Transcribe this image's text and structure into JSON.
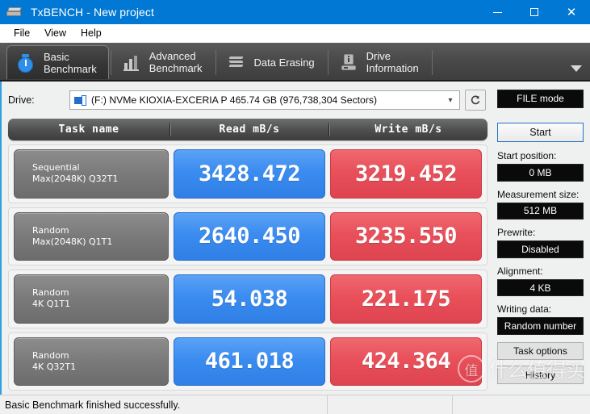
{
  "window": {
    "title": "TxBENCH - New project",
    "icon": "drive-icon",
    "minimize_label": "—",
    "maximize_label": "□",
    "close_label": "✕"
  },
  "menu": {
    "items": [
      {
        "label": "File"
      },
      {
        "label": "View"
      },
      {
        "label": "Help"
      }
    ]
  },
  "toolbar": {
    "tabs": [
      {
        "line1": "Basic",
        "line2": "Benchmark",
        "icon": "stopwatch-icon",
        "active": true
      },
      {
        "line1": "Advanced",
        "line2": "Benchmark",
        "icon": "bar-chart-icon",
        "active": false
      },
      {
        "line1": "Data Erasing",
        "line2": "",
        "icon": "eraser-icon",
        "active": false
      },
      {
        "line1": "Drive",
        "line2": "Information",
        "icon": "drive-info-icon",
        "active": false
      }
    ],
    "overflow_icon": "chevron-down-icon"
  },
  "drive": {
    "label": "Drive:",
    "selected": "(F:) NVMe KIOXIA-EXCERIA P  465.74 GB (976,738,304 Sectors)",
    "dropdown_icon": "chevron-down-icon",
    "refresh_icon": "refresh-icon"
  },
  "results": {
    "columns": [
      "Task name",
      "Read mB/s",
      "Write mB/s"
    ],
    "rows": [
      {
        "task_line1": "Sequential",
        "task_line2": "Max(2048K) Q32T1",
        "read": "3428.472",
        "write": "3219.452"
      },
      {
        "task_line1": "Random",
        "task_line2": "Max(2048K) Q1T1",
        "read": "2640.450",
        "write": "3235.550"
      },
      {
        "task_line1": "Random",
        "task_line2": "4K Q1T1",
        "read": "54.038",
        "write": "221.175"
      },
      {
        "task_line1": "Random",
        "task_line2": "4K Q32T1",
        "read": "461.018",
        "write": "424.364"
      }
    ],
    "read_color": "#3b8cf0",
    "write_color": "#e8505a"
  },
  "sidebar": {
    "mode": "FILE mode",
    "start_button": "Start",
    "fields": [
      {
        "label": "Start position:",
        "value": "0 MB"
      },
      {
        "label": "Measurement size:",
        "value": "512 MB"
      },
      {
        "label": "Prewrite:",
        "value": "Disabled"
      },
      {
        "label": "Alignment:",
        "value": "4 KB"
      },
      {
        "label": "Writing data:",
        "value": "Random number"
      }
    ],
    "buttons": [
      {
        "label": "Task options"
      },
      {
        "label": "History"
      }
    ]
  },
  "statusbar": {
    "message": "Basic Benchmark finished successfully."
  },
  "watermark": {
    "logo_char": "值",
    "text": "什么值得买"
  }
}
